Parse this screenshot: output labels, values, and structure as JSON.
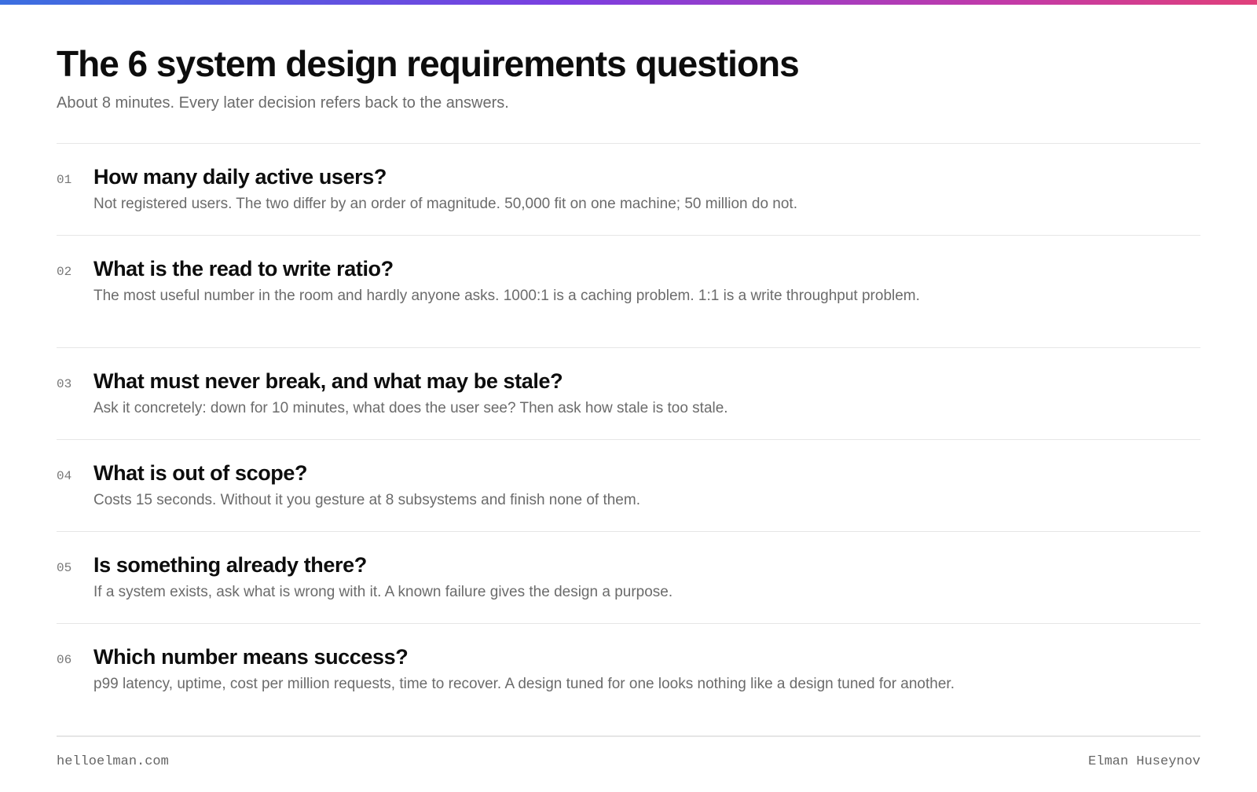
{
  "header": {
    "title": "The 6 system design requirements questions",
    "subtitle": "About 8 minutes. Every later decision refers back to the answers."
  },
  "questions": [
    {
      "number": "01",
      "title": "How many daily active users?",
      "description": "Not registered users. The two differ by an order of magnitude. 50,000 fit on one machine; 50 million do not."
    },
    {
      "number": "02",
      "title": "What is the read to write ratio?",
      "description": "The most useful number in the room and hardly anyone asks. 1000:1 is a caching problem. 1:1 is a write throughput problem."
    },
    {
      "number": "03",
      "title": "What must never break, and what may be stale?",
      "description": "Ask it concretely: down for 10 minutes, what does the user see? Then ask how stale is too stale."
    },
    {
      "number": "04",
      "title": "What is out of scope?",
      "description": "Costs 15 seconds. Without it you gesture at 8 subsystems and finish none of them."
    },
    {
      "number": "05",
      "title": "Is something already there?",
      "description": "If a system exists, ask what is wrong with it. A known failure gives the design a purpose."
    },
    {
      "number": "06",
      "title": "Which number means success?",
      "description": "p99 latency, uptime, cost per million requests, time to recover. A design tuned for one looks nothing like a design tuned for another."
    }
  ],
  "footer": {
    "website": "helloelman.com",
    "author": "Elman Huseynov"
  }
}
